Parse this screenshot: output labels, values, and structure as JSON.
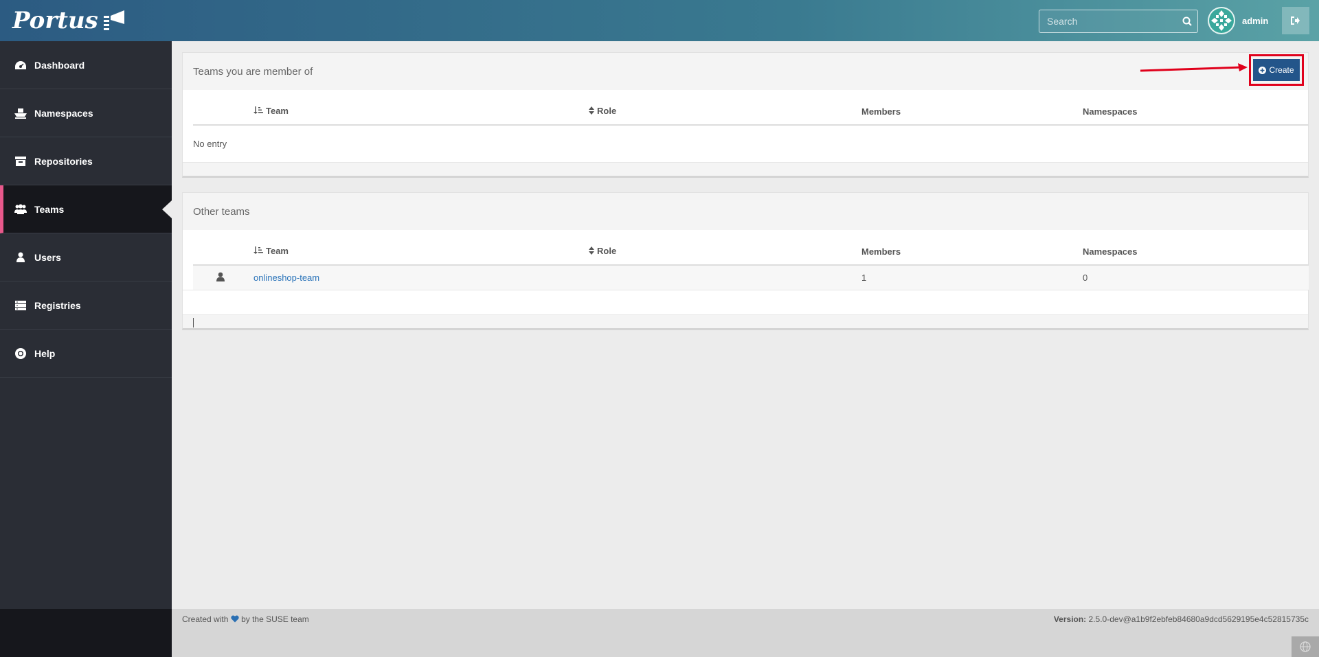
{
  "brand": {
    "name": "Portus"
  },
  "search": {
    "placeholder": "Search"
  },
  "user": {
    "name": "admin"
  },
  "sidebar": {
    "items": [
      {
        "label": "Dashboard",
        "icon": "dashboard-icon"
      },
      {
        "label": "Namespaces",
        "icon": "namespaces-icon"
      },
      {
        "label": "Repositories",
        "icon": "repositories-icon"
      },
      {
        "label": "Teams",
        "icon": "teams-icon",
        "active": true
      },
      {
        "label": "Users",
        "icon": "users-icon"
      },
      {
        "label": "Registries",
        "icon": "registries-icon"
      },
      {
        "label": "Help",
        "icon": "help-icon"
      }
    ]
  },
  "member_teams": {
    "title": "Teams you are member of",
    "create_label": "Create",
    "columns": [
      "Team",
      "Role",
      "Members",
      "Namespaces"
    ],
    "empty_text": "No entry"
  },
  "other_teams": {
    "title": "Other teams",
    "columns": [
      "Team",
      "Role",
      "Members",
      "Namespaces"
    ],
    "rows": [
      {
        "team": "onlineshop-team",
        "role": "",
        "members": "1",
        "namespaces": "0"
      }
    ]
  },
  "footer": {
    "created_prefix": "Created with",
    "created_suffix": "by the SUSE team",
    "version_label": "Version:",
    "version_value": "2.5.0-dev@a1b9f2ebfeb84680a9dcd5629195e4c52815735c"
  },
  "colors": {
    "accent": "#e8588b",
    "primary_button": "#23558a",
    "highlight": "#e0001b",
    "link": "#2a73b9"
  }
}
